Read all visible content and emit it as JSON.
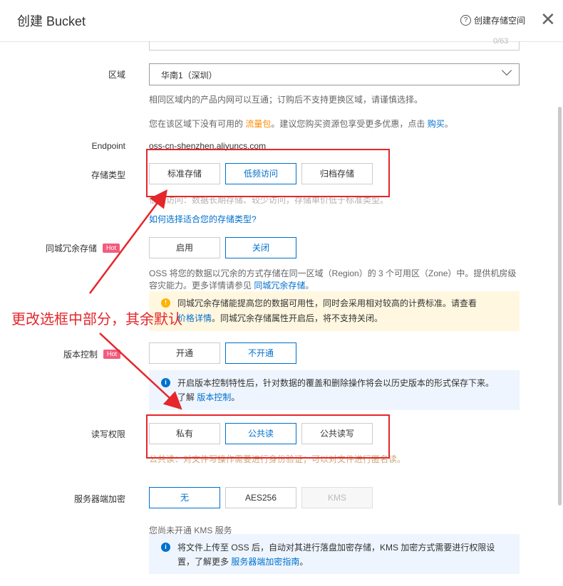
{
  "header": {
    "title": "创建 Bucket",
    "help_label": "创建存储空间",
    "help_icon": "question-circle-icon",
    "close_icon": "close-icon"
  },
  "name_field": {
    "counter": "0/63"
  },
  "region": {
    "label": "区域",
    "value": "华南1（深圳）",
    "note": "相同区域内的产品内网可以互通；订购后不支持更换区域，请谨慎选择。",
    "note2_prefix": "您在该区域下没有可用的",
    "note2_link": "流量包",
    "note2_mid": "。建议您购买资源包享受更多优惠，点击",
    "note2_link2": "购买",
    "note2_end": "。"
  },
  "endpoint": {
    "label": "Endpoint",
    "value": "oss-cn-shenzhen.aliyuncs.com"
  },
  "storage_class": {
    "label": "存储类型",
    "options": [
      "标准存储",
      "低频访问",
      "归档存储"
    ],
    "selected": "低频访问",
    "note": "低频访问：数据长期存储、较少访问，存储单价低于标准类型。",
    "link": "如何选择适合您的存储类型?"
  },
  "redundancy": {
    "label": "同城冗余存储",
    "hot": "Hot",
    "options": [
      "启用",
      "关闭"
    ],
    "selected": "关闭",
    "note_line1": "OSS 将您的数据以冗余的方式存储在同一区域（Region）的 3 个可用区（Zone）中。提供机房级",
    "note_line2_prefix": "容灾能力。更多详情请参见",
    "note_link": "同城冗余存储",
    "note_line2_end": "。",
    "warn_line1": "同城冗余存储能提高您的数据可用性，同时会采用相对较高的计费标准。请查看",
    "warn_link": "价格详情",
    "warn_line2_rest": "。同城冗余存储属性开启后，将不支持关闭。"
  },
  "versioning": {
    "label": "版本控制",
    "hot": "Hot",
    "options": [
      "开通",
      "不开通"
    ],
    "selected": "不开通",
    "info_line1": "开启版本控制特性后，针对数据的覆盖和删除操作将会以历史版本的形式保存下来。",
    "info_line2_prefix": "了解",
    "info_link": "版本控制",
    "info_line2_end": "。"
  },
  "acl": {
    "label": "读写权限",
    "options": [
      "私有",
      "公共读",
      "公共读写"
    ],
    "selected": "公共读",
    "note": "公共读：对文件写操作需要进行身份验证；可以对文件进行匿名读。"
  },
  "encryption": {
    "label": "服务器端加密",
    "options": [
      "无",
      "AES256",
      "KMS"
    ],
    "selected": "无",
    "disabled": "KMS",
    "note": "您尚未开通 KMS 服务",
    "info_line1": "将文件上传至 OSS 后，自动对其进行落盘加密存储，KMS 加密方式需要进行权限设",
    "info_line2_prefix": "置，了解更多",
    "info_link": "服务器端加密指南",
    "info_line2_end": "。"
  },
  "annotation": {
    "text": "更改选框中部分，其余默认",
    "color": "#e5262b"
  },
  "colors": {
    "accent": "#0070cc",
    "hot": "#f25c7f",
    "annotation": "#e5262b",
    "warn_bg": "#fff7e0",
    "info_bg": "#eef5fe"
  }
}
